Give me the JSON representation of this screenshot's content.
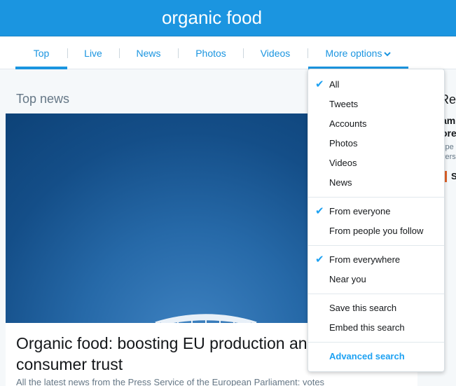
{
  "header": {
    "title": "organic food"
  },
  "nav": {
    "tabs": [
      "Top",
      "Live",
      "News",
      "Photos",
      "Videos"
    ],
    "more_label": "More options",
    "accent_color": "#1b95e0"
  },
  "main": {
    "section_title": "Top news",
    "card": {
      "headline": "Organic food: boosting EU production and enhancing consumer trust",
      "summary": "All the latest news from the Press Service of the European Parliament: votes"
    }
  },
  "right_column": {
    "title_fragment": "Rela",
    "line1": "am",
    "line2": "ore",
    "line3": "xpe",
    "line4": "vers",
    "badge": "S"
  },
  "dropdown": {
    "groups": [
      {
        "items": [
          {
            "label": "All",
            "checked": true
          },
          {
            "label": "Tweets",
            "checked": false
          },
          {
            "label": "Accounts",
            "checked": false
          },
          {
            "label": "Photos",
            "checked": false
          },
          {
            "label": "Videos",
            "checked": false
          },
          {
            "label": "News",
            "checked": false
          }
        ]
      },
      {
        "items": [
          {
            "label": "From everyone",
            "checked": true
          },
          {
            "label": "From people you follow",
            "checked": false
          }
        ]
      },
      {
        "items": [
          {
            "label": "From everywhere",
            "checked": true
          },
          {
            "label": "Near you",
            "checked": false
          }
        ]
      },
      {
        "items": [
          {
            "label": "Save this search",
            "checked": false
          },
          {
            "label": "Embed this search",
            "checked": false
          }
        ]
      },
      {
        "items": [
          {
            "label": "Advanced search",
            "checked": false,
            "link": true
          }
        ]
      }
    ],
    "check_icon": "checkmark-icon"
  }
}
